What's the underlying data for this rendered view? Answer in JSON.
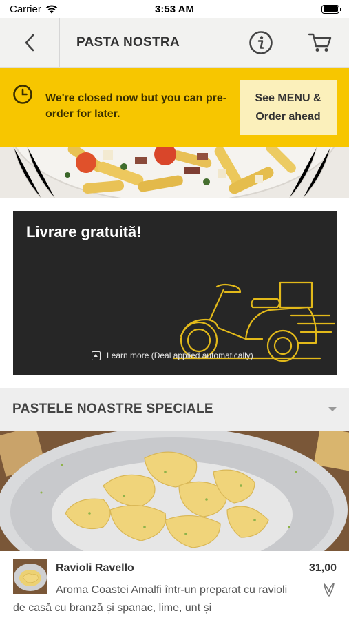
{
  "status_bar": {
    "carrier": "Carrier",
    "time": "3:53 AM"
  },
  "header": {
    "title": "PASTA NOSTRA",
    "icons": [
      "back-icon",
      "info-icon",
      "cart-icon"
    ]
  },
  "closed_banner": {
    "message": "We're closed now but you can pre-order for later.",
    "button_line1": "See MENU &",
    "button_line2": "Order ahead",
    "color": "#f7c600",
    "button_color": "#fbf0bb"
  },
  "promo": {
    "title": "Livrare gratuită!",
    "link_text": "Learn more (Deal applied automatically)",
    "background": "#262626",
    "accent": "#e2b91a"
  },
  "section": {
    "title": "PASTELE NOASTRE SPECIALE"
  },
  "menu_items": [
    {
      "name": "Ravioli Ravello",
      "price": "31,00",
      "description": "Aroma Coastei Amalfi într-un preparat cu ravioli de casă cu branză și spanac, lime, unt și",
      "badge_icon": "vegetarian-leaf-icon"
    }
  ]
}
